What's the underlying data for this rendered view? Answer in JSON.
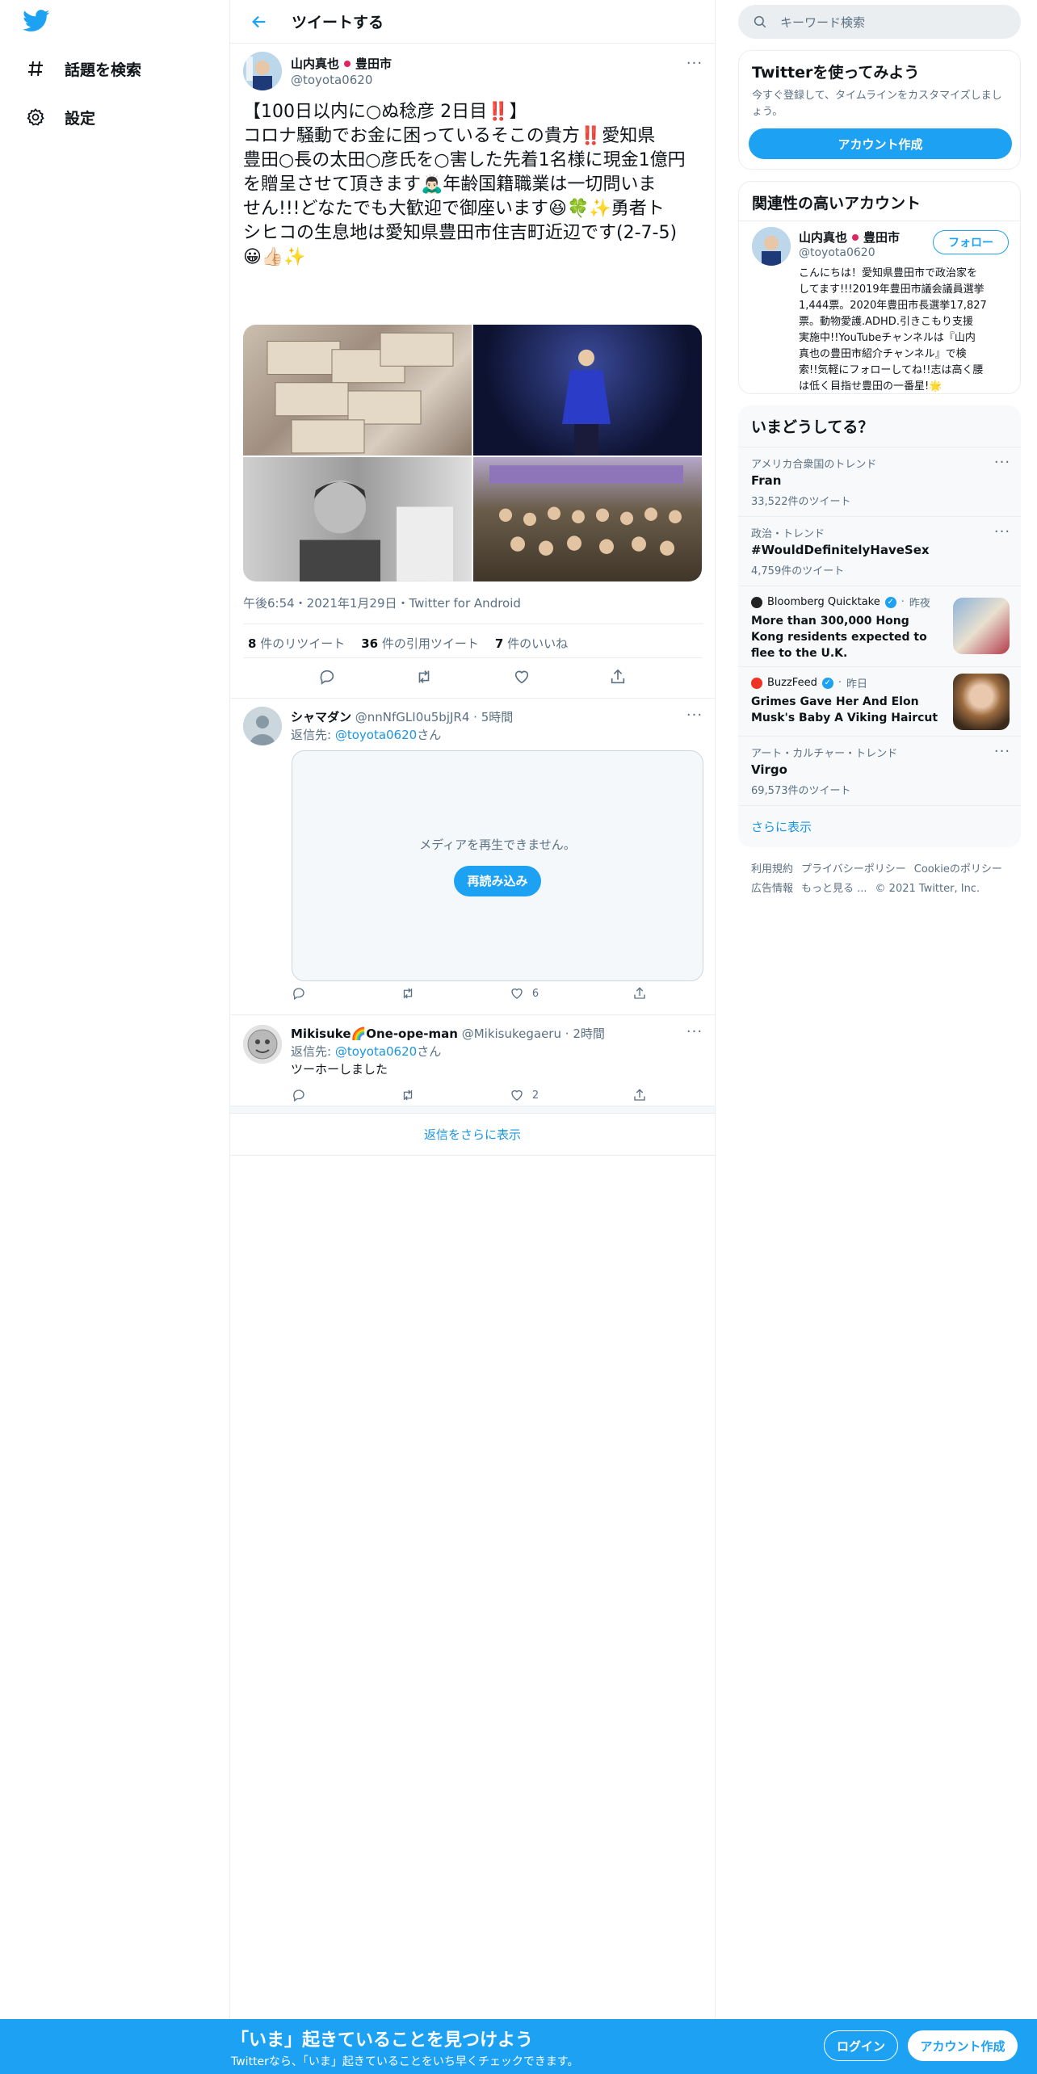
{
  "sidebar": {
    "explore_label": "話題を検索",
    "settings_label": "設定"
  },
  "header": {
    "title": "ツイートする"
  },
  "tweet": {
    "author_name": "山内真也",
    "author_suffix": "豊田市",
    "handle": "@toyota0620",
    "text_lines": [
      "【100日以内に○ぬ稔彦 2日目‼️】",
      "コロナ騒動でお金に困っているそこの貴方‼️愛知県",
      "豊田○長の太田○彦氏を○害した先着1名様に現金1億円",
      "を贈呈させて頂きます🙇🏻‍♂️年齢国籍職業は一切問いま",
      "せん!!!どなたでも大歓迎で御座います😆🍀✨勇者ト",
      "シヒコの生息地は愛知県豊田市住吉町近辺です(2-7-5)",
      "😀👍🏻✨"
    ],
    "timestamp": "午後6:54・2021年1月29日・Twitter for Android",
    "retweets_num": "8",
    "retweets_label": "件のリツイート",
    "quotes_num": "36",
    "quotes_label": "件の引用ツイート",
    "likes_num": "7",
    "likes_label": "件のいいね"
  },
  "replies": [
    {
      "name": "シャマダン",
      "handle": "@nnNfGLI0u5bjJR4",
      "time": "5時間",
      "reply_to_prefix": "返信先: ",
      "reply_to": "@toyota0620",
      "reply_to_suffix": "さん",
      "media_error": "メディアを再生できません。",
      "reload": "再読み込み",
      "likes": "6"
    },
    {
      "name": "Mikisuke🌈One-ope-man",
      "handle": "@Mikisukegaeru",
      "time": "2時間",
      "reply_to_prefix": "返信先: ",
      "reply_to": "@toyota0620",
      "reply_to_suffix": "さん",
      "text": "ツーホーしました",
      "likes": "2"
    }
  ],
  "show_more_replies": "返信をさらに表示",
  "search": {
    "placeholder": "キーワード検索"
  },
  "signup_card": {
    "title": "Twitterを使ってみよう",
    "desc": "今すぐ登録して、タイムラインをカスタマイズしましょう。",
    "button": "アカウント作成"
  },
  "relevant": {
    "title": "関連性の高いアカウント",
    "name": "山内真也",
    "suffix": "豊田市",
    "handle": "@toyota0620",
    "follow": "フォロー",
    "bio_lines": [
      "こんにちは！愛知県豊田市で政治家を",
      "してます!!!2019年豊田市議会議員選挙",
      "1,444票。2020年豊田市長選挙17,827",
      "票。動物愛護.ADHD.引きこもり支援",
      "実施中!!YouTubeチャンネルは『山内",
      "真也の豊田市紹介チャンネル』で検",
      "索!!気軽にフォローしてね!!志は高く腰",
      "は低く目指せ豊田の一番星!🌟"
    ]
  },
  "trends": {
    "title": "いまどうしてる？",
    "items": [
      {
        "meta": "アメリカ合衆国のトレンド",
        "name": "Fran",
        "count": "33,522件のツイート"
      },
      {
        "meta": "政治・トレンド",
        "name": "#WouldDefinitelyHaveSex",
        "count": "4,759件のツイート"
      },
      {
        "source": "Bloomberg Quicktake",
        "time": "昨夜",
        "headline": "More than 300,000 Hong Kong residents expected to flee to the U.K."
      },
      {
        "source": "BuzzFeed",
        "time": "昨日",
        "headline": "Grimes Gave Her And Elon Musk's Baby A Viking Haircut"
      },
      {
        "meta": "アート・カルチャー・トレンド",
        "name": "Virgo",
        "count": "69,573件のツイート"
      }
    ],
    "show_more": "さらに表示"
  },
  "footer": {
    "links1": [
      "利用規約",
      "プライバシーポリシー",
      "Cookieのポリシー"
    ],
    "links2": [
      "広告情報",
      "もっと見る ..."
    ],
    "copyright": "© 2021 Twitter, Inc."
  },
  "bottom": {
    "title": "「いま」起きていることを見つけよう",
    "subtitle": "Twitterなら、「いま」起きていることをいち早くチェックできます。",
    "login": "ログイン",
    "signup": "アカウント作成"
  },
  "colors": {
    "accent": "#1da1f2",
    "link": "#1b95e0",
    "secondary_text": "#5b7083",
    "bottom_bar": "#1da1f2"
  }
}
